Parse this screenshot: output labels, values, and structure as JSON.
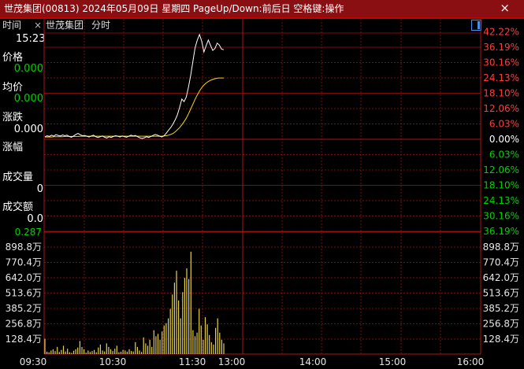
{
  "window": {
    "title": "世茂集团(00813) 2024年05月09日 星期四 PageUp/Down:前后日 空格键:操作",
    "close_glyph": "×"
  },
  "tabs": {
    "time_label": "时间",
    "close_glyph": "×",
    "stock_name": "世茂集团",
    "chart_mode": "分时"
  },
  "info_panel": {
    "time_value": "15:23",
    "price_label": "价格",
    "price_value": "0.000",
    "avg_label": "均价",
    "avg_value": "0.000",
    "change_label": "涨跌",
    "change_value": "0.000",
    "pct_label": "涨幅",
    "volume_label": "成交量",
    "volume_value": "0",
    "amount_label": "成交额",
    "amount_value": "0.0"
  },
  "colors": {
    "up": "#ff3c3c",
    "down": "#00d000",
    "grid": "#7a0d0d",
    "price_line": "#ffffff",
    "avg_line": "#ffd700",
    "volume_bar": "#e6d24a",
    "title_bar": "#8a0f12"
  },
  "chart_data": {
    "type": "line",
    "reference_price": 0.287,
    "price_axis": {
      "up_labels": [
        "42.22%",
        "36.19%",
        "30.16%",
        "24.13%",
        "18.10%",
        "12.06%",
        "6.03%"
      ],
      "zero_label": "0.00%",
      "down_labels": [
        "6.03%",
        "12.06%",
        "18.10%",
        "24.13%",
        "30.16%",
        "36.19%"
      ],
      "left_bottom_label": "0.287",
      "ylim_pct": [
        -36.19,
        42.22
      ]
    },
    "volume_axis": {
      "labels": [
        "898.8万",
        "770.4万",
        "642.0万",
        "513.6万",
        "385.2万",
        "256.8万",
        "128.4万"
      ],
      "ylim": [
        0,
        898.8
      ]
    },
    "x_ticks": [
      "09:30",
      "10:30",
      "11:30",
      "13:00",
      "14:00",
      "15:00",
      "16:00"
    ],
    "series": [
      {
        "values_pct": [
          0.9,
          1.4,
          1.1,
          1.6,
          1.2,
          1.8,
          1.5,
          1.3,
          1.7,
          1.4,
          1.6,
          1.1,
          0.8,
          1.3,
          1.9,
          2.3,
          1.8,
          1.4,
          1.5,
          1.2,
          0.9,
          1.3,
          1.6,
          1.0,
          0.7,
          1.0,
          1.3,
          0.8,
          0.5,
          1.0,
          0.7,
          1.1,
          1.4,
          1.2,
          0.9,
          1.3,
          1.0,
          0.8,
          1.2,
          1.6,
          1.3,
          1.5,
          1.0,
          0.6,
          0.3,
          0.6,
          1.0,
          0.7,
          1.1,
          1.5,
          1.9,
          1.6,
          1.2,
          0.9,
          1.4,
          2.4,
          3.6,
          4.6,
          6.0,
          7.6,
          9.6,
          12.6,
          15.8,
          14.8,
          16.6,
          20.5,
          25.1,
          30.6,
          36.0,
          39.0,
          41.2,
          38.5,
          34.3,
          36.8,
          39.0,
          36.9,
          34.9,
          35.7,
          37.8,
          37.0,
          35.4,
          35.2
        ]
      },
      {
        "values_pct": [
          0.9,
          0.9,
          0.9,
          0.9,
          1.0,
          1.0,
          1.0,
          1.0,
          1.0,
          1.1,
          1.1,
          1.1,
          1.1,
          1.1,
          1.1,
          1.1,
          1.2,
          1.2,
          1.2,
          1.2,
          1.2,
          1.2,
          1.2,
          1.2,
          1.2,
          1.2,
          1.2,
          1.2,
          1.2,
          1.2,
          1.2,
          1.2,
          1.2,
          1.2,
          1.2,
          1.2,
          1.2,
          1.2,
          1.2,
          1.2,
          1.2,
          1.2,
          1.2,
          1.2,
          1.2,
          1.2,
          1.2,
          1.2,
          1.2,
          1.2,
          1.2,
          1.2,
          1.2,
          1.2,
          1.3,
          1.4,
          1.6,
          1.9,
          2.3,
          2.9,
          3.7,
          4.6,
          5.7,
          6.9,
          8.3,
          10.0,
          11.9,
          13.8,
          15.7,
          17.4,
          19.0,
          20.3,
          21.3,
          22.1,
          22.7,
          23.2,
          23.5,
          23.8,
          24.0,
          24.1,
          24.1,
          24.1
        ]
      }
    ],
    "volume": [
      128,
      20,
      15,
      30,
      40,
      25,
      60,
      18,
      35,
      70,
      22,
      45,
      15,
      10,
      28,
      40,
      55,
      110,
      60,
      40,
      12,
      30,
      18,
      25,
      35,
      15,
      55,
      80,
      30,
      22,
      90,
      60,
      40,
      25,
      45,
      70,
      15,
      20,
      35,
      30,
      20,
      40,
      25,
      22,
      100,
      60,
      30,
      18,
      140,
      90,
      70,
      120,
      60,
      200,
      150,
      170,
      120,
      190,
      240,
      260,
      300,
      380,
      500,
      600,
      700,
      450,
      300,
      520,
      640,
      720,
      630,
      860,
      200,
      150,
      180,
      380,
      240,
      120,
      310,
      250,
      160,
      100,
      80,
      220,
      300,
      180,
      120,
      90
    ]
  }
}
